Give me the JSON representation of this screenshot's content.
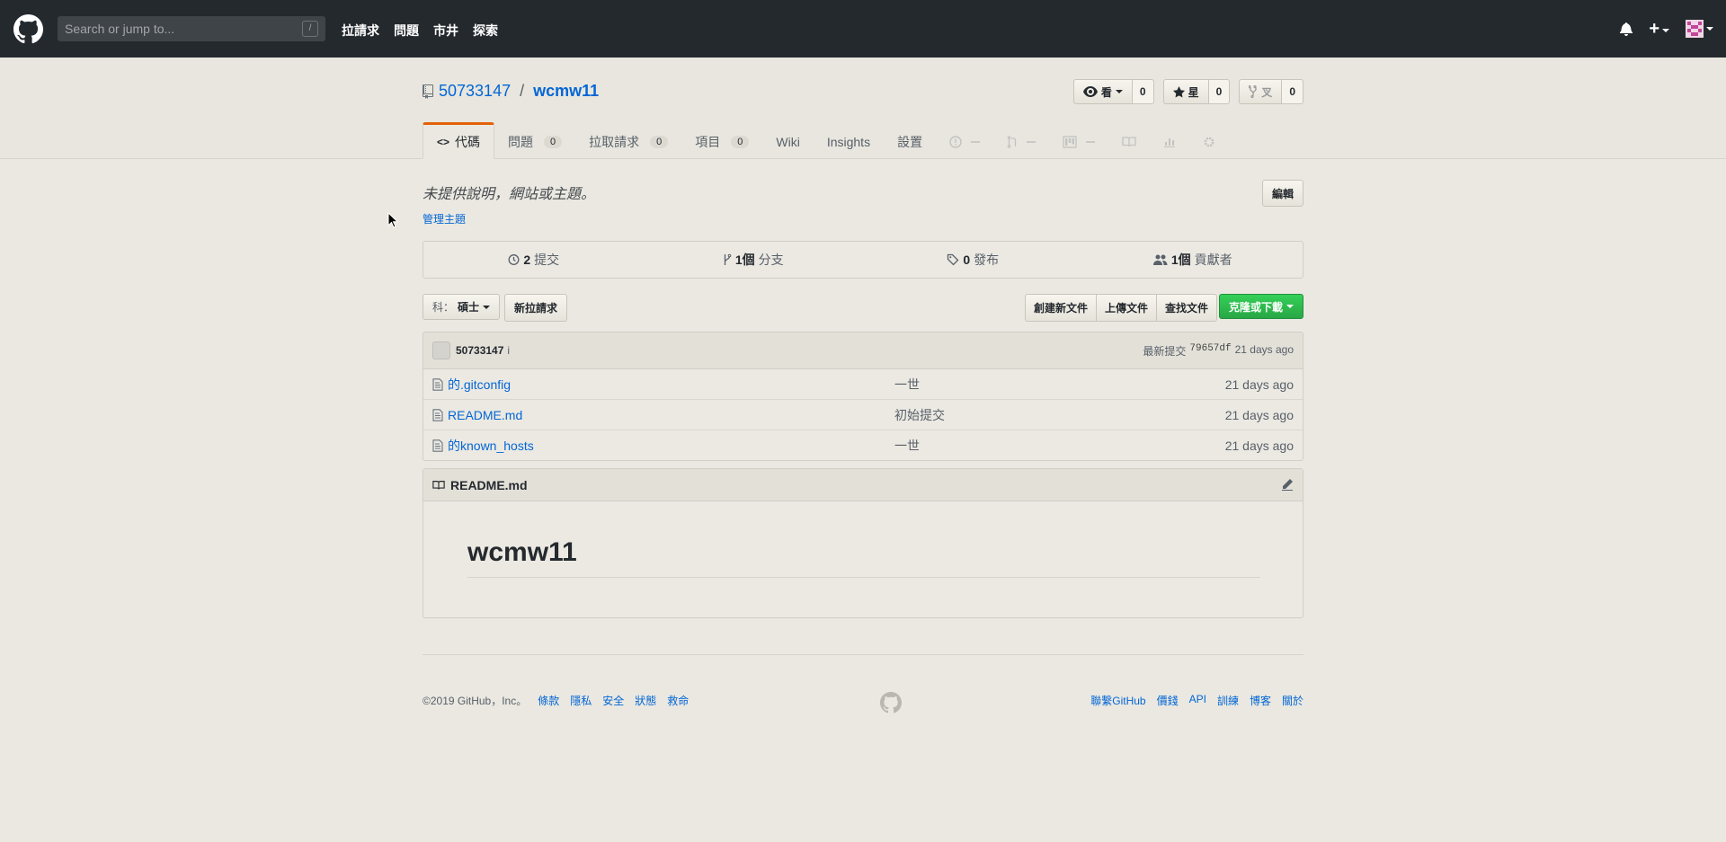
{
  "topbar": {
    "search_placeholder": "Search or jump to...",
    "slash_key": "/",
    "nav": [
      "拉請求",
      "問題",
      "市井",
      "探索"
    ]
  },
  "repo": {
    "owner": "50733147",
    "separator": "/",
    "name": "wcmw11",
    "watch_label": "看",
    "watch_count": "0",
    "star_label": "星",
    "star_count": "0",
    "fork_label": "叉",
    "fork_count": "0",
    "tabs": [
      {
        "label": "代碼",
        "counter": ""
      },
      {
        "label": "問題",
        "counter": "0"
      },
      {
        "label": "拉取請求",
        "counter": "0"
      },
      {
        "label": "項目",
        "counter": "0"
      },
      {
        "label": "Wiki",
        "counter": ""
      },
      {
        "label": "Insights",
        "counter": ""
      },
      {
        "label": "設置",
        "counter": ""
      }
    ],
    "tab_code_prefix": "<>"
  },
  "summary": {
    "description": "未提供說明，網站或主題。",
    "manage_topics": "管理主題",
    "edit_button": "編輯",
    "commits_count": "2",
    "commits_label": "提交",
    "branches_count": "1個",
    "branches_label": "分支",
    "releases_count": "0",
    "releases_label": "發布",
    "contributors_count": "1個",
    "contributors_label": "貢獻者"
  },
  "file_nav": {
    "branch_prefix": "科：",
    "branch_name": "碩士",
    "new_pr": "新拉請求",
    "create_file": "創建新文件",
    "upload_files": "上傳文件",
    "find_file": "查找文件",
    "clone_download": "克隆或下載"
  },
  "commit": {
    "author": "50733147",
    "hint": "i",
    "latest_label": "最新提交",
    "sha": "79657df",
    "age": "21 days ago"
  },
  "files": [
    {
      "name": "的.gitconfig",
      "message": "一世",
      "age": "21 days ago"
    },
    {
      "name": "README.md",
      "message": "初始提交",
      "age": "21 days ago"
    },
    {
      "name": "的known_hosts",
      "message": "一世",
      "age": "21 days ago"
    }
  ],
  "readme": {
    "filename": "README.md",
    "heading": "wcmw11"
  },
  "footer": {
    "copyright": "©2019 GitHub，Inc。",
    "left_links": [
      "條款",
      "隱私",
      "安全",
      "狀態",
      "救命"
    ],
    "right_links": [
      "聯繫GitHub",
      "價錢",
      "API",
      "訓練",
      "博客",
      "關於"
    ]
  },
  "colors": {
    "accent": "#0366d6",
    "header_bg": "#24292e",
    "page_bg": "#eae8e1",
    "clone_green": "#28a745",
    "tab_selected": "#e36209"
  }
}
